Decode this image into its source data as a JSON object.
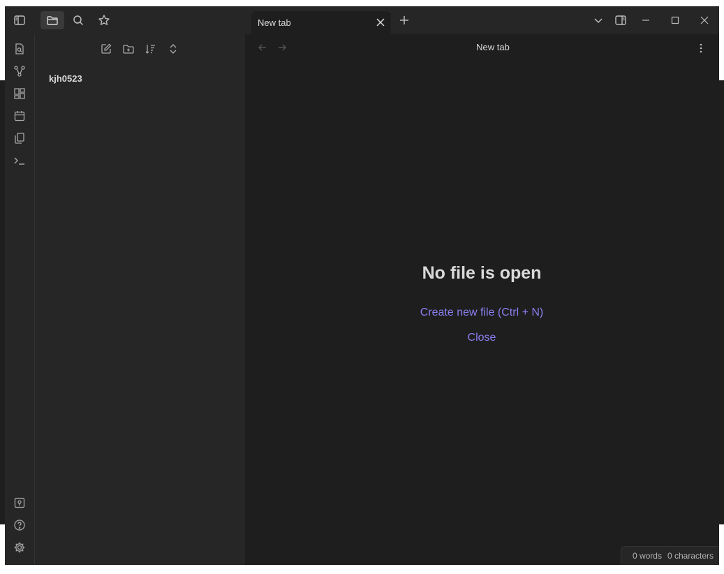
{
  "titlebar": {
    "buttons": {
      "toggle_left_sidebar": "sidebar-left-icon",
      "file_explorer": "folder-icon",
      "search": "search-icon",
      "bookmarks": "star-icon"
    },
    "tab": {
      "title": "New tab"
    },
    "new_tab_icon": "plus-icon",
    "window_controls": [
      "chevron-down-icon",
      "sidebar-right-icon",
      "minimize-icon",
      "maximize-icon",
      "close-icon"
    ]
  },
  "ribbon": {
    "top_icons": [
      "open-quick-switcher-icon",
      "graph-view-icon",
      "canvas-icon",
      "daily-note-icon",
      "templates-icon",
      "command-palette-icon"
    ],
    "bottom_icons": [
      "vault-switcher-icon",
      "help-icon",
      "settings-icon"
    ]
  },
  "sidebar": {
    "tools": [
      "new-note-icon",
      "new-folder-icon",
      "sort-icon",
      "expand-collapse-icon"
    ],
    "vault_name": "kjh0523"
  },
  "main": {
    "view_title": "New tab",
    "empty_state": {
      "title": "No file is open",
      "create_link": "Create new file (Ctrl + N)",
      "close_link": "Close"
    }
  },
  "status": {
    "words": "0 words",
    "characters": "0 characters"
  },
  "colors": {
    "accent": "#8a7ff0",
    "background": "#1e1e1e",
    "panel": "#262626",
    "text": "#dadada"
  }
}
